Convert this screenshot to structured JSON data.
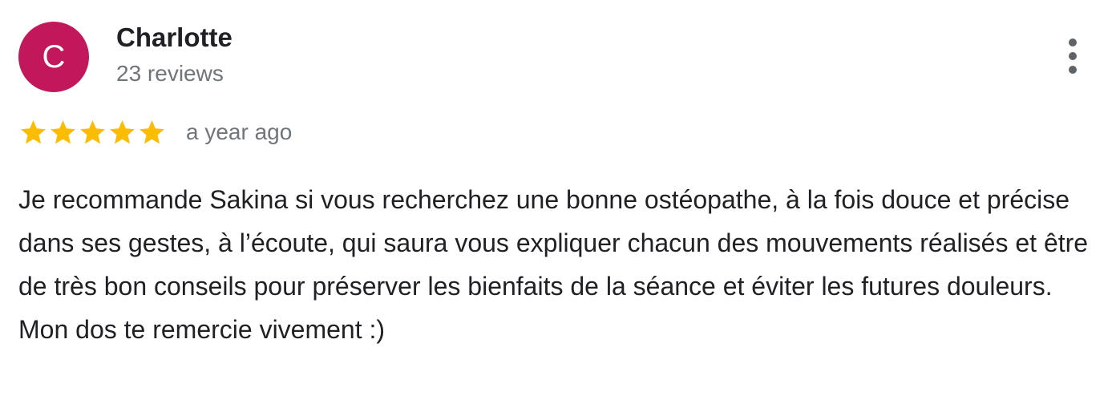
{
  "reviewer": {
    "initial": "C",
    "name": "Charlotte",
    "review_count": "23 reviews",
    "avatar_color": "#c2185b"
  },
  "menu": {
    "icon": "more-vert-icon"
  },
  "rating": {
    "stars": 5,
    "max": 5,
    "star_color": "#fbbc04",
    "time_ago": "a year ago"
  },
  "review": {
    "text": "Je recommande Sakina si vous recherchez une bonne ostéopathe, à la fois douce et précise dans ses gestes, à l’écoute, qui saura vous expliquer chacun des mouvements réalisés et être de très bon conseils pour préserver les bienfaits de la séance et éviter les futures douleurs. Mon dos te remercie vivement :)"
  }
}
